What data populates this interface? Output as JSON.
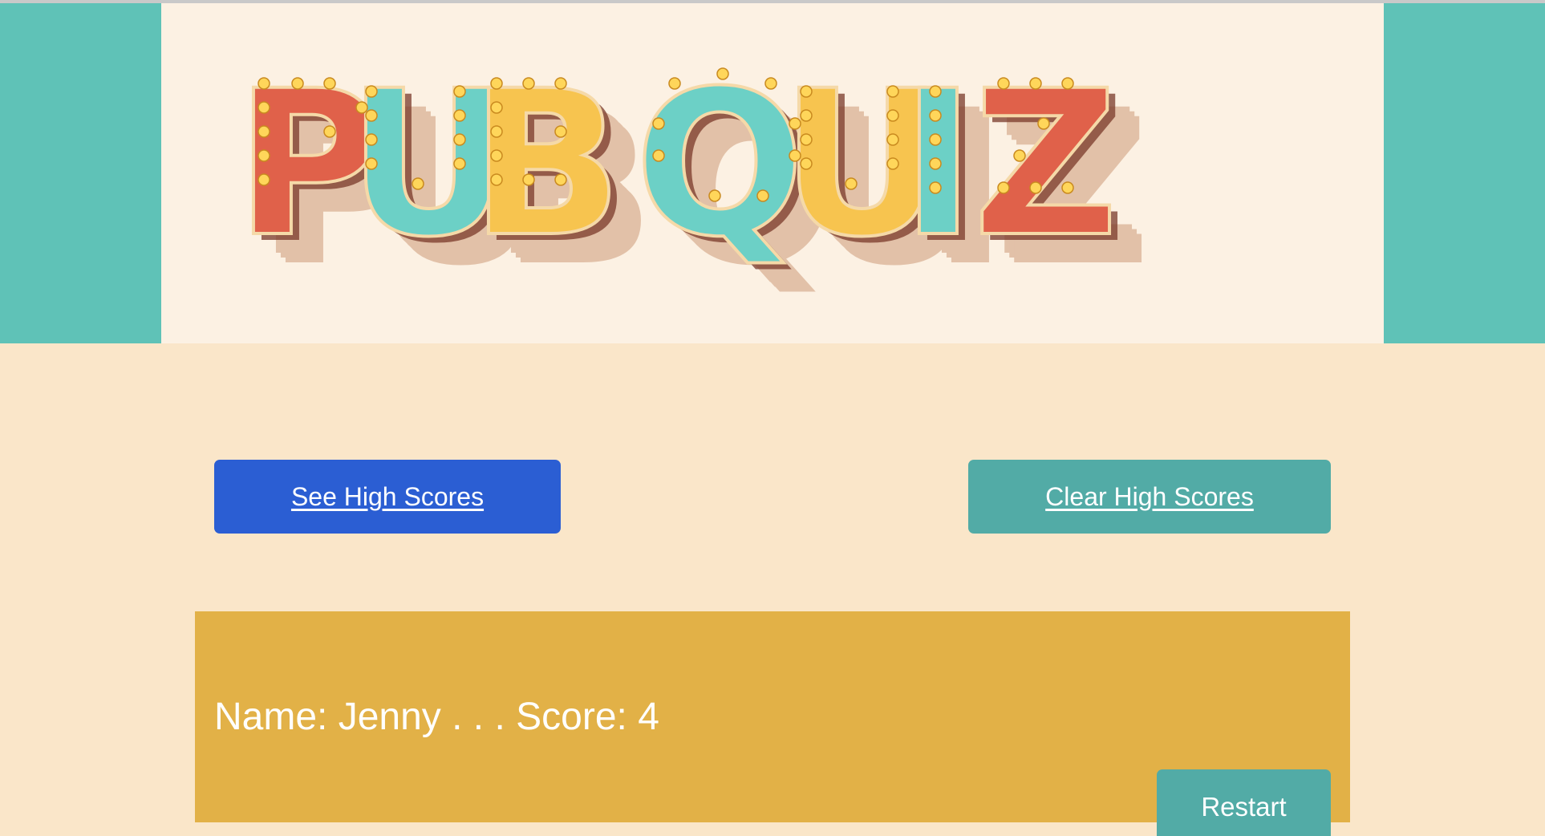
{
  "logo": {
    "text": "PUB QUIZ",
    "letters": [
      "P",
      "U",
      "B",
      "Q",
      "U",
      "I",
      "Z"
    ],
    "colors": {
      "red": "#e0614a",
      "teal": "#6cd0c6",
      "yellow": "#f7c44f",
      "shadow": "#e2c1a8"
    }
  },
  "buttons": {
    "see_high_scores": "See High Scores",
    "clear_high_scores": "Clear High Scores",
    "restart": "Restart"
  },
  "score": {
    "entry": "Name: Jenny . . . Score: 4"
  },
  "colors": {
    "header_band": "#5fc2b7",
    "banner_bg": "#fcf1e3",
    "page_bg": "#fae6c9",
    "primary_button": "#2b5ed3",
    "secondary_button": "#52aba6",
    "score_panel": "#e2b147"
  }
}
